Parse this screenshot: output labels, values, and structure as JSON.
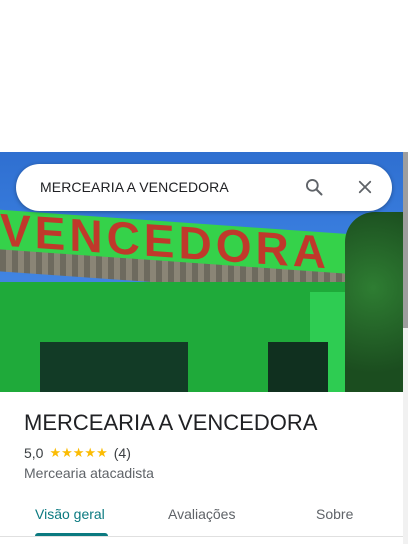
{
  "search": {
    "query": "MERCEARIA A VENCEDORA"
  },
  "photo": {
    "sign_text": "VENCEDORA"
  },
  "place": {
    "name": "MERCEARIA A VENCEDORA",
    "rating": "5,0",
    "stars": "★★★★★",
    "review_count": "(4)",
    "category": "Mercearia atacadista"
  },
  "tabs": [
    {
      "label": "Visão geral",
      "active": true
    },
    {
      "label": "Avaliações",
      "active": false
    },
    {
      "label": "Sobre",
      "active": false
    }
  ],
  "colors": {
    "accent": "#0b7a80",
    "star": "#fbbc04"
  }
}
